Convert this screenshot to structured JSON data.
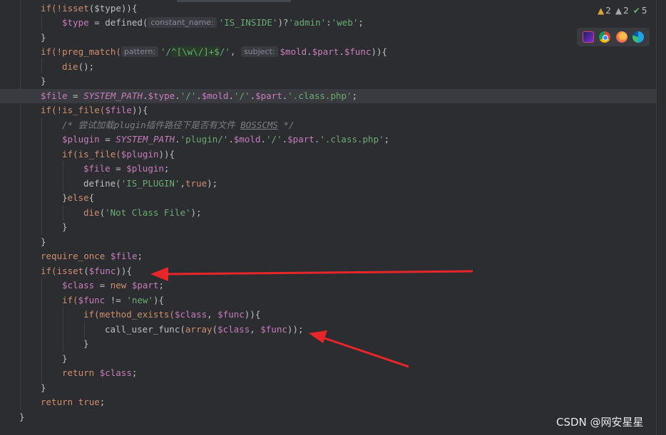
{
  "inspections": {
    "warnings": "2",
    "weak_warnings": "2",
    "ok": "5"
  },
  "browsers": [
    "phpstorm-icon",
    "chrome-icon",
    "firefox-icon",
    "edge-icon"
  ],
  "hints": {
    "constant_name": "constant_name:",
    "pattern": "pattern:",
    "subject": "subject:"
  },
  "code_text": {
    "l1_a": "if(!",
    "l1_b": "isset",
    "l1_c": "($type)){",
    "l2_a": "$type",
    "l2_b": " = defined(",
    "l2_c": "'IS_INSIDE'",
    "l2_d": ")?",
    "l2_e": "'admin'",
    "l2_f": ":",
    "l2_g": "'web'",
    "l2_h": ";",
    "l3": "}",
    "l4_a": "if(!preg_match(",
    "l4_b": "'/",
    "l4_c": "^[\\w\\/]+$",
    "l4_d": "/'",
    "l4_e": ", ",
    "l4_f": "$mold",
    "l4_g": ".",
    "l4_h": "$part",
    "l4_i": ".",
    "l4_j": "$func",
    "l4_k": ")){",
    "l5_a": "die",
    "l5_b": "();",
    "l6": "}",
    "l7_a": "$file",
    "l7_b": " = ",
    "l7_c": "SYSTEM_PATH",
    "l7_d": ".",
    "l7_e": "$type",
    "l7_f": ".",
    "l7_g": "'/'",
    "l7_h": ".",
    "l7_i": "$mold",
    "l7_j": ".",
    "l7_k": "'/'",
    "l7_l": ".",
    "l7_m": "$part",
    "l7_n": ".",
    "l7_o": "'.class.php'",
    "l7_p": ";",
    "l8_a": "if(!is_file(",
    "l8_b": "$file",
    "l8_c": ")){",
    "l9_a": "/* 尝试加载plugin插件路径下是否有文件 ",
    "l9_b": "BOSSCMS",
    "l9_c": " */",
    "l10_a": "$plugin",
    "l10_b": " = ",
    "l10_c": "SYSTEM_PATH",
    "l10_d": ".",
    "l10_e": "'plugin/'",
    "l10_f": ".",
    "l10_g": "$mold",
    "l10_h": ".",
    "l10_i": "'/'",
    "l10_j": ".",
    "l10_k": "$part",
    "l10_l": ".",
    "l10_m": "'.class.php'",
    "l10_n": ";",
    "l11_a": "if(is_file(",
    "l11_b": "$plugin",
    "l11_c": ")){",
    "l12_a": "$file",
    "l12_b": " = ",
    "l12_c": "$plugin",
    "l12_d": ";",
    "l13_a": "define(",
    "l13_b": "'IS_PLUGIN'",
    "l13_c": ",",
    "l13_d": "true",
    "l13_e": ");",
    "l14_a": "}",
    "l14_b": "else",
    "l14_c": "{",
    "l15_a": "die",
    "l15_b": "(",
    "l15_c": "'Not Class File'",
    "l15_d": ");",
    "l16": "}",
    "l17": "}",
    "l18_a": "require_once",
    "l18_b": " ",
    "l18_c": "$file",
    "l18_d": ";",
    "l19_a": "if(",
    "l19_b": "isset",
    "l19_c": "(",
    "l19_d": "$func",
    "l19_e": ")){",
    "l20_a": "$class",
    "l20_b": " = ",
    "l20_c": "new",
    "l20_d": " ",
    "l20_e": "$part",
    "l20_f": ";",
    "l21_a": "if(",
    "l21_b": "$func",
    "l21_c": " != ",
    "l21_d": "'new'",
    "l21_e": "){",
    "l22_a": "if(method_exists(",
    "l22_b": "$class",
    "l22_c": ", ",
    "l22_d": "$func",
    "l22_e": ")){",
    "l23_a": "call_user_func(",
    "l23_b": "array",
    "l23_c": "(",
    "l23_d": "$class",
    "l23_e": ", ",
    "l23_f": "$func",
    "l23_g": "));",
    "l24": "}",
    "l25": "}",
    "l26_a": "return",
    "l26_b": " ",
    "l26_c": "$class",
    "l26_d": ";",
    "l27": "}",
    "l28_a": "return",
    "l28_b": " ",
    "l28_c": "true",
    "l28_d": ";",
    "l29": "}"
  },
  "watermark": "CSDN @网安星星",
  "colors": {
    "background": "#2b2d30",
    "keyword": "#cf8e6d",
    "variable": "#c77dbb",
    "string": "#6aab73",
    "comment": "#7a7e85",
    "arrow": "#e8262a"
  }
}
